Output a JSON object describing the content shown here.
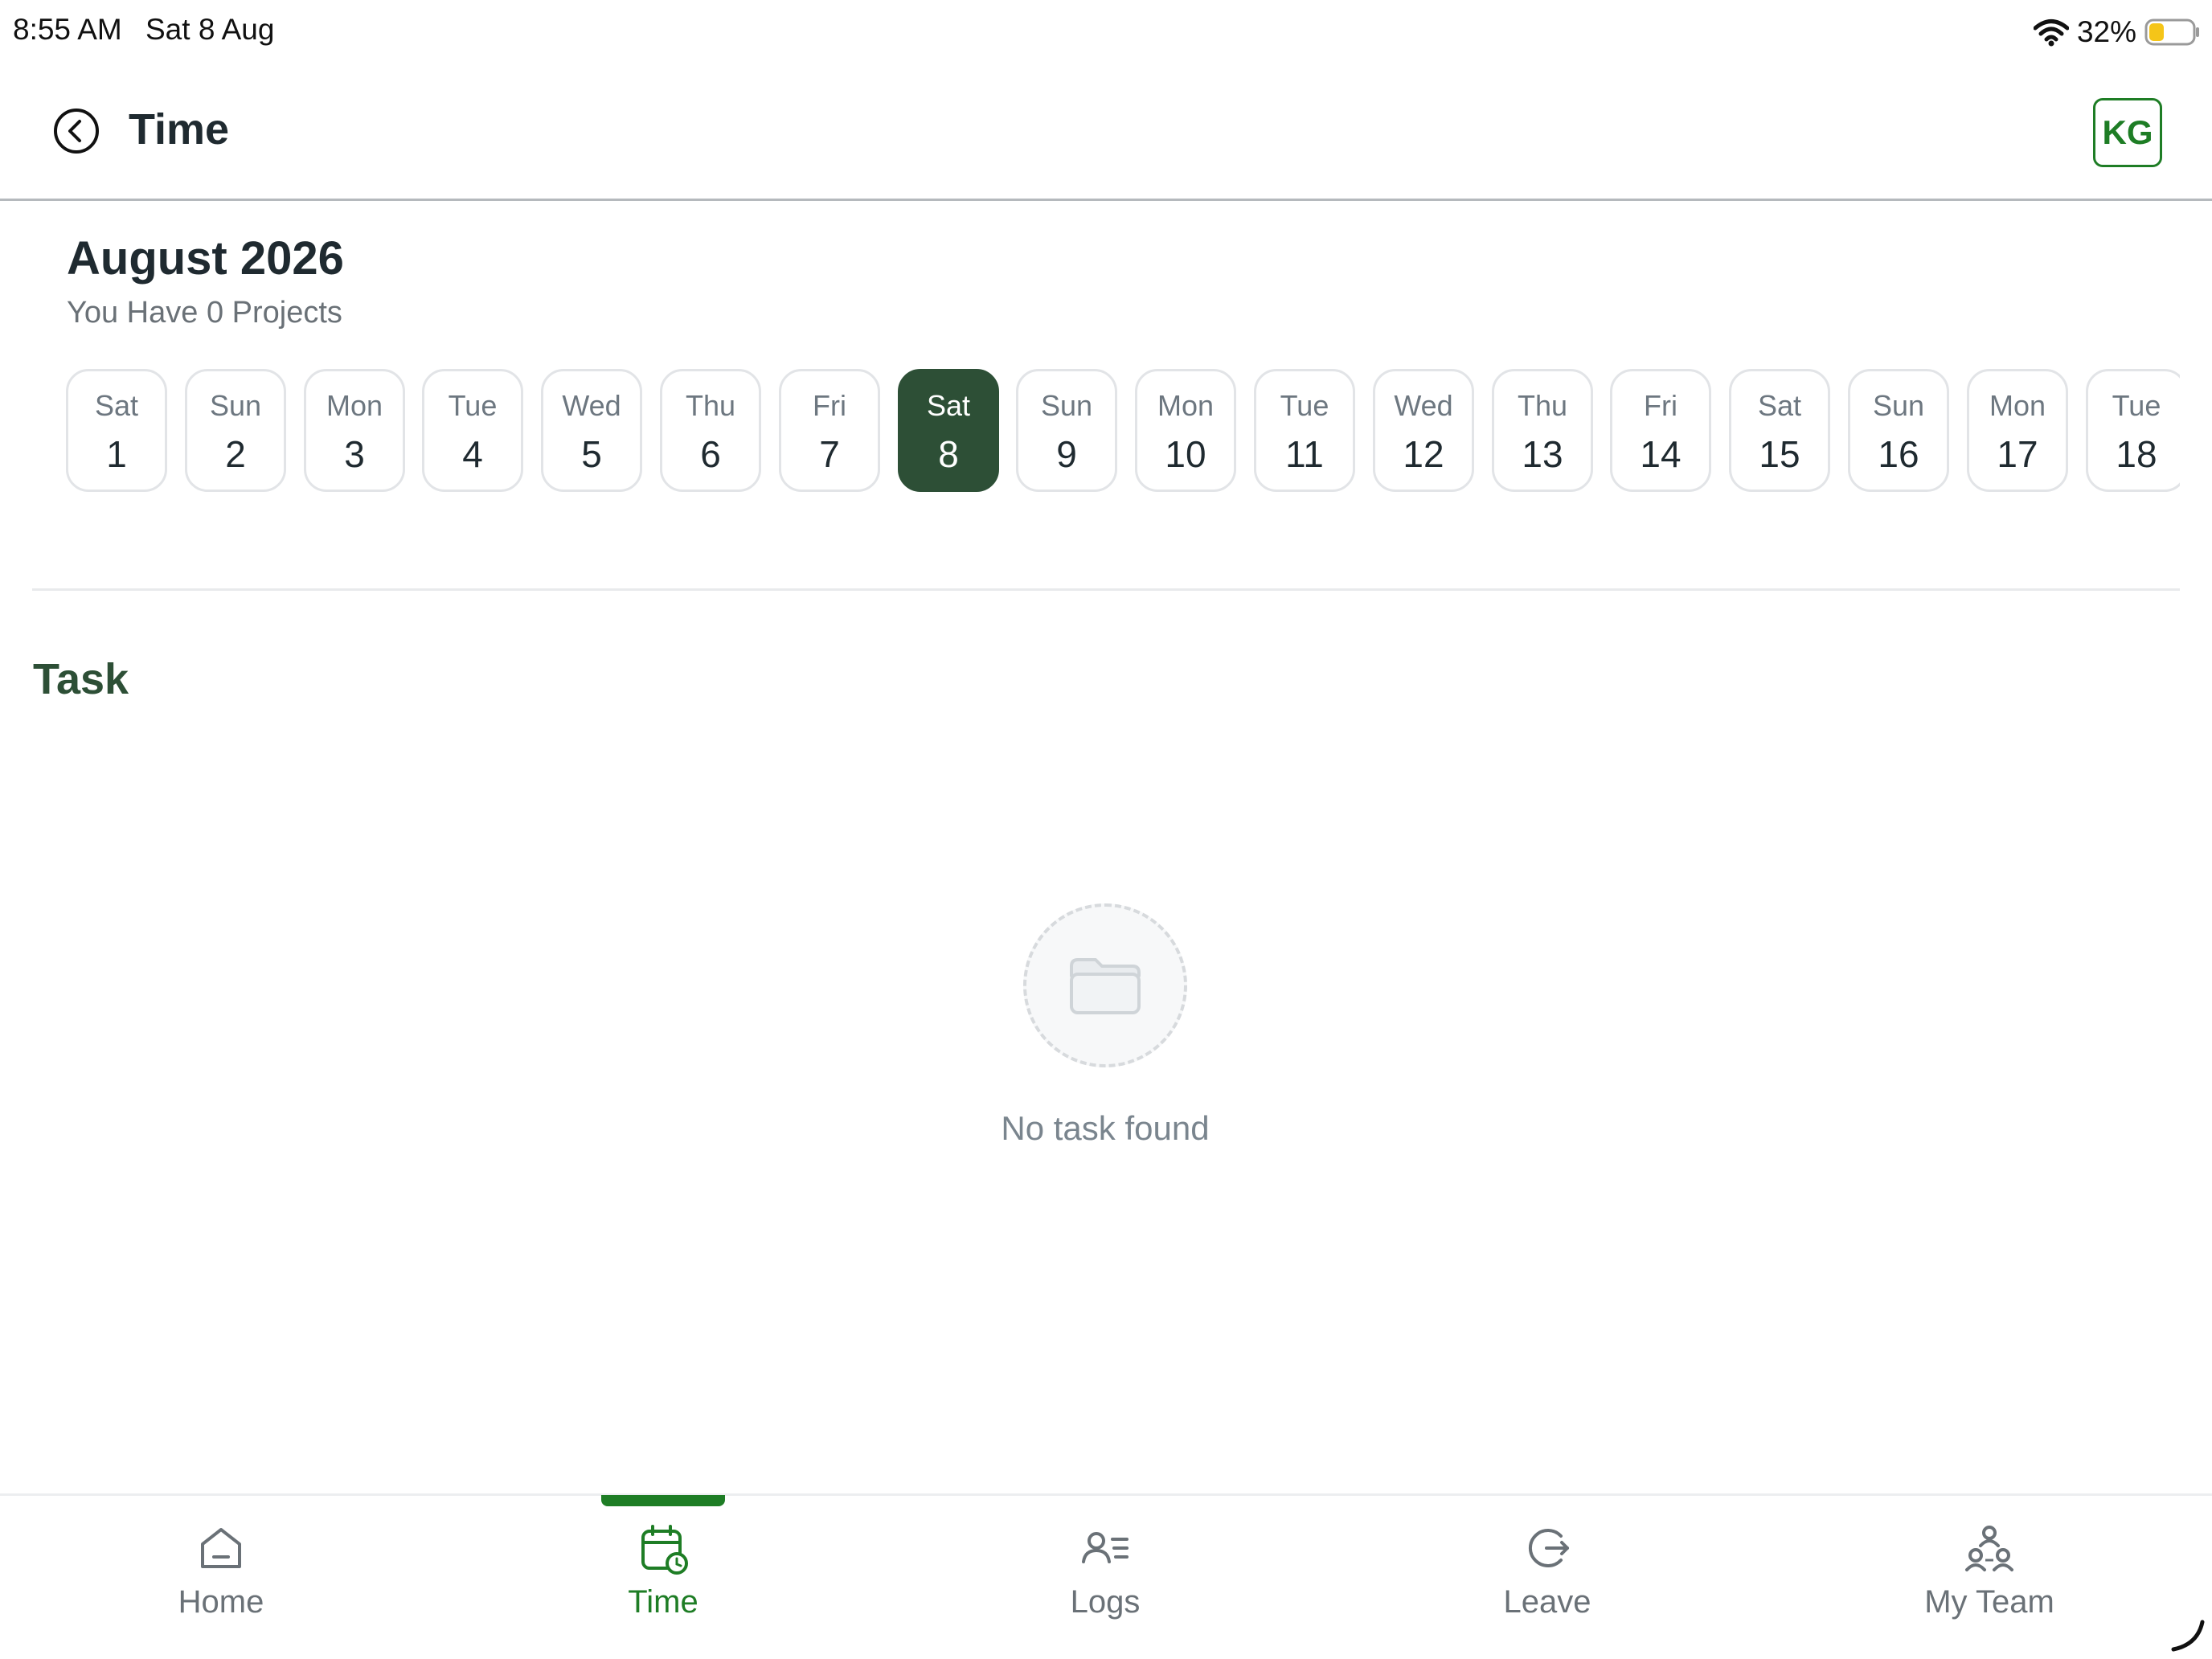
{
  "status_bar": {
    "time": "8:55 AM",
    "date": "Sat 8 Aug",
    "battery": "32%"
  },
  "header": {
    "title": "Time",
    "avatar_initials": "KG"
  },
  "month": {
    "title": "August 2026",
    "projects": "You Have 0 Projects"
  },
  "days": [
    {
      "name": "Sat",
      "num": "1"
    },
    {
      "name": "Sun",
      "num": "2"
    },
    {
      "name": "Mon",
      "num": "3"
    },
    {
      "name": "Tue",
      "num": "4"
    },
    {
      "name": "Wed",
      "num": "5"
    },
    {
      "name": "Thu",
      "num": "6"
    },
    {
      "name": "Fri",
      "num": "7"
    },
    {
      "name": "Sat",
      "num": "8",
      "selected": true
    },
    {
      "name": "Sun",
      "num": "9"
    },
    {
      "name": "Mon",
      "num": "10"
    },
    {
      "name": "Tue",
      "num": "11"
    },
    {
      "name": "Wed",
      "num": "12"
    },
    {
      "name": "Thu",
      "num": "13"
    },
    {
      "name": "Fri",
      "num": "14"
    },
    {
      "name": "Sat",
      "num": "15"
    },
    {
      "name": "Sun",
      "num": "16"
    },
    {
      "name": "Mon",
      "num": "17"
    },
    {
      "name": "Tue",
      "num": "18"
    }
  ],
  "task_section": {
    "title": "Task",
    "empty_text": "No task found"
  },
  "nav": [
    {
      "label": "Home",
      "icon": "home-icon"
    },
    {
      "label": "Time",
      "icon": "calendar-clock-icon",
      "active": true
    },
    {
      "label": "Logs",
      "icon": "user-list-icon"
    },
    {
      "label": "Leave",
      "icon": "logout-arrow-icon"
    },
    {
      "label": "My Team",
      "icon": "team-icon"
    }
  ],
  "colors": {
    "accent": "#1e7d25",
    "selected_day": "#2d4f36",
    "muted_text": "#6a7177"
  }
}
